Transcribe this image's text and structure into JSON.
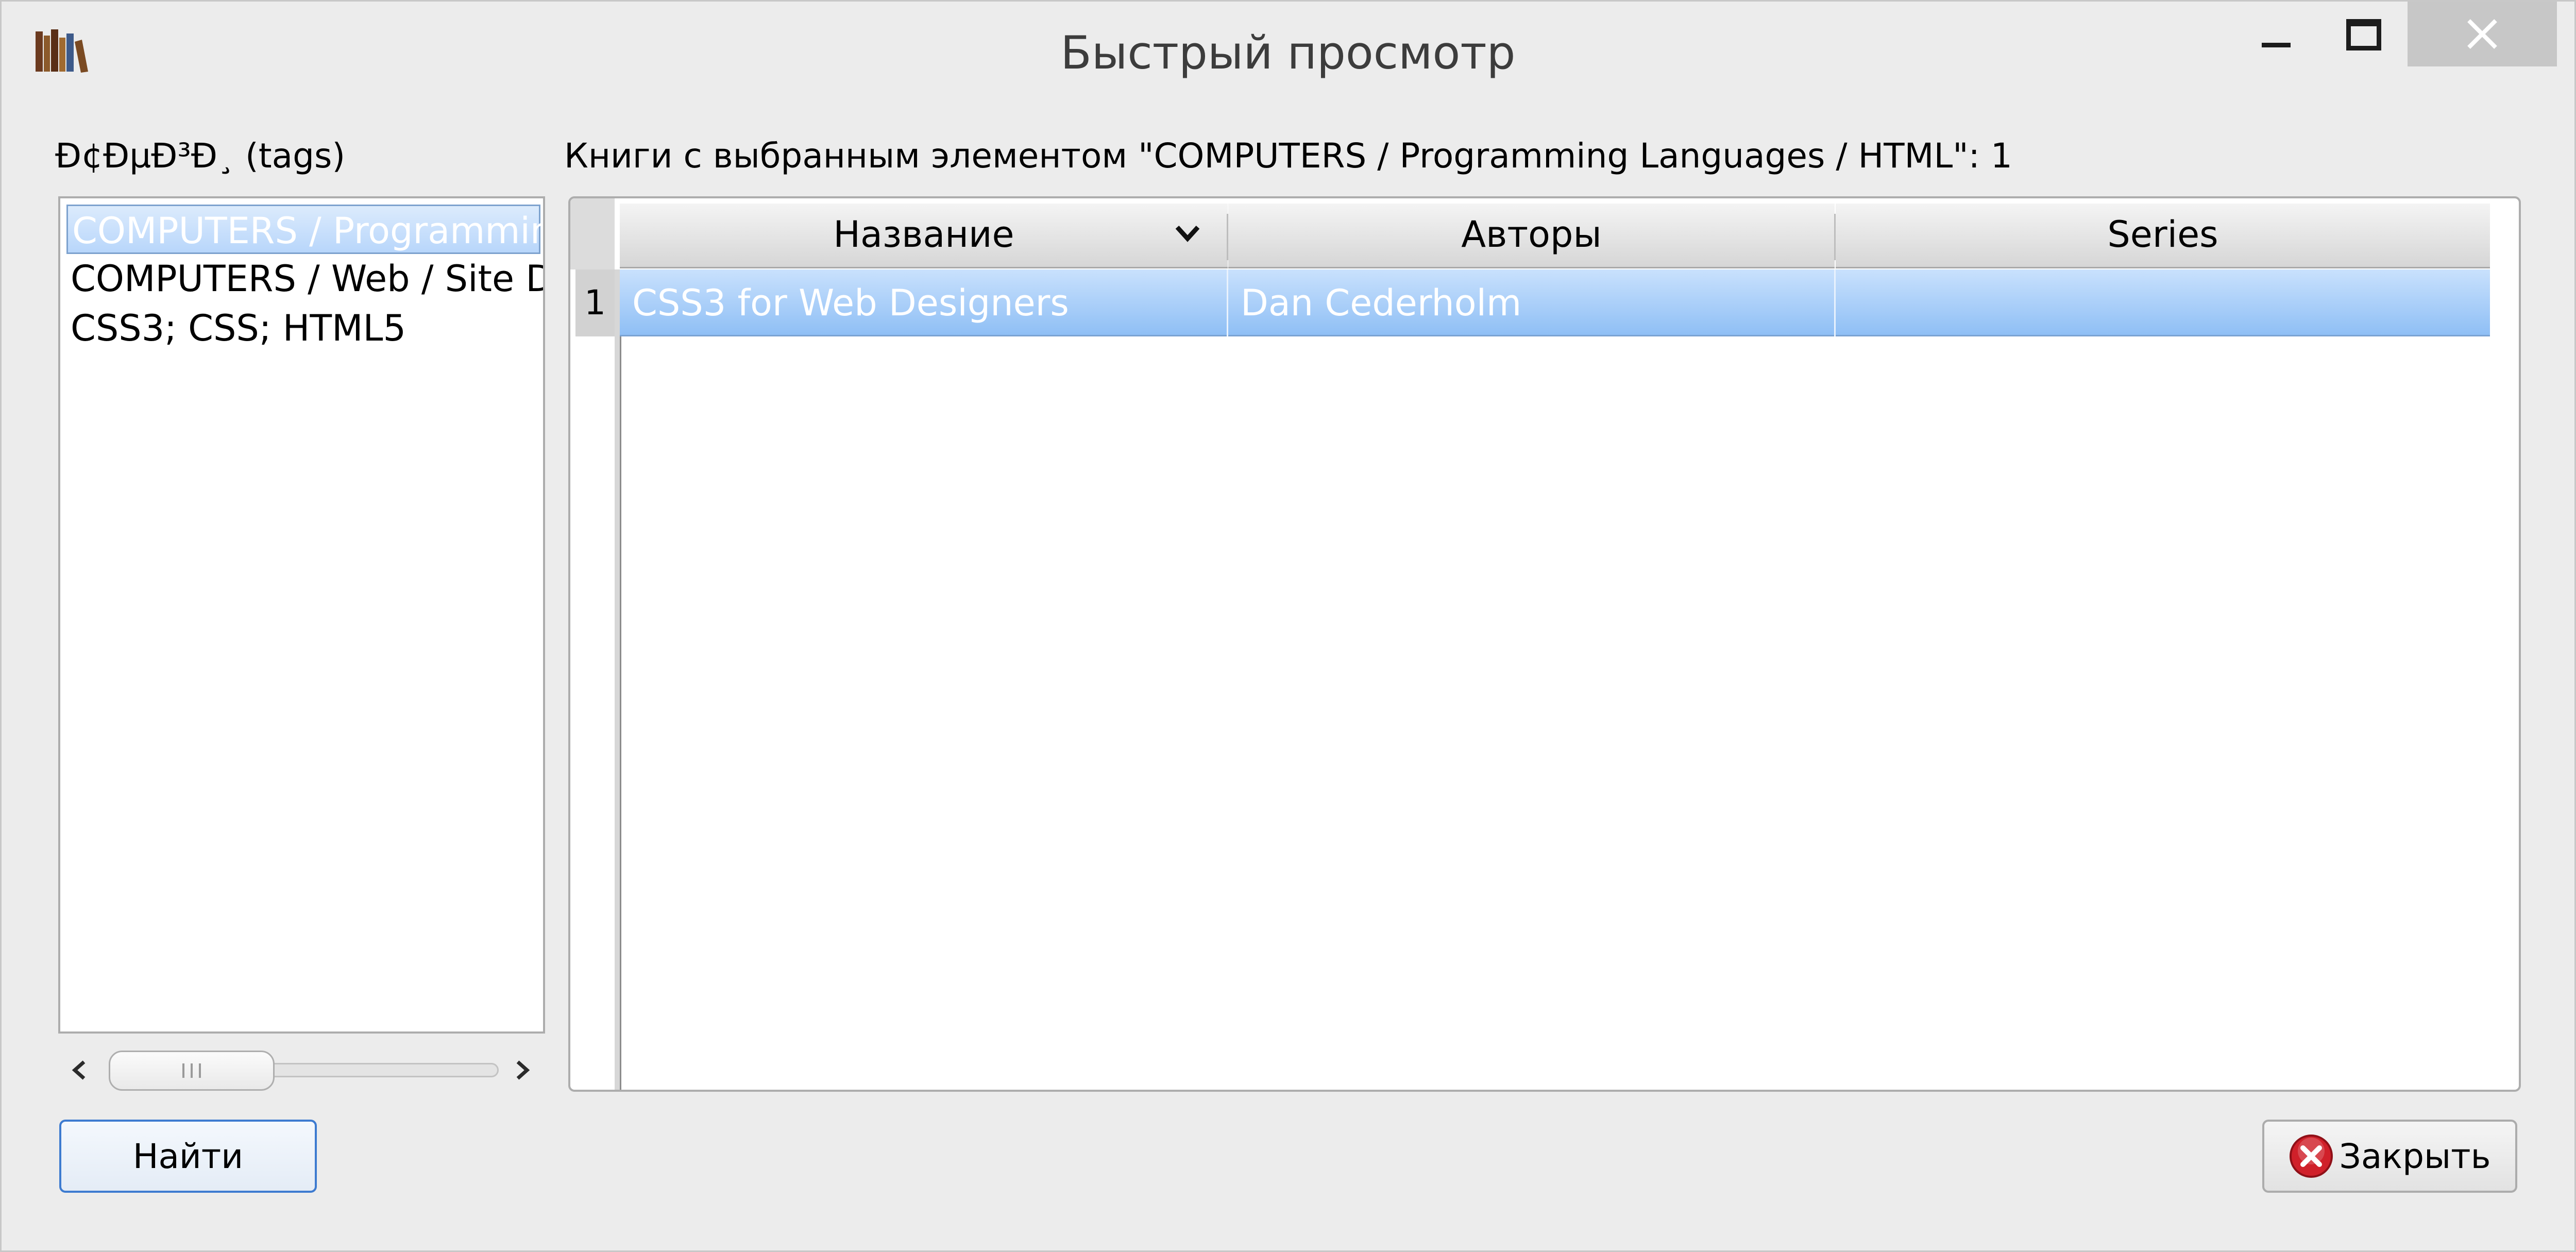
{
  "window": {
    "title": "Быстрый просмотр"
  },
  "tags": {
    "label": "Ð¢ÐµÐ³Ð¸ (tags)",
    "items": [
      "COMPUTERS / Programming Languages / HTML",
      "COMPUTERS / Web / Site Design",
      "CSS3; CSS; HTML5"
    ],
    "selected_index": 0
  },
  "results": {
    "label": "Книги с выбранным элементом \"COMPUTERS / Programming Languages / HTML\": 1",
    "columns": [
      "Название",
      "Авторы",
      "Series"
    ],
    "rows": [
      {
        "number": "1",
        "title": "CSS3 for Web Designers",
        "authors": "Dan Cederholm",
        "series": ""
      }
    ]
  },
  "buttons": {
    "find": "Найти",
    "close": "Закрыть"
  },
  "icons": {
    "app": "books-icon",
    "sort": "chevron-down-icon",
    "close": "red-x-circle-icon"
  },
  "colors": {
    "selection": "#9cc6f7",
    "close_icon": "#d0202a",
    "focus_border": "#3d7bd0"
  }
}
